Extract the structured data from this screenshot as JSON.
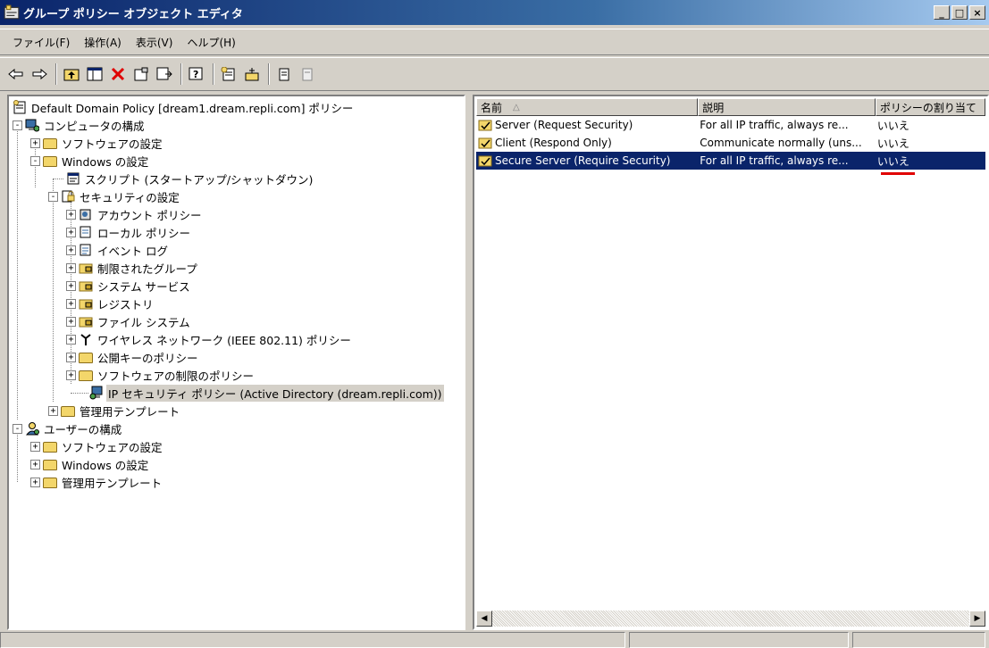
{
  "window": {
    "title": "グループ ポリシー オブジェクト エディタ",
    "buttons": {
      "minimize": "_",
      "maximize": "□",
      "close": "×"
    }
  },
  "menu": [
    "ファイル(F)",
    "操作(A)",
    "表示(V)",
    "ヘルプ(H)"
  ],
  "toolbar": {
    "icons": [
      "back-arrow-icon",
      "forward-arrow-icon",
      "up-folder-icon",
      "show-hide-tree-icon",
      "delete-icon",
      "properties-icon",
      "export-list-icon",
      "help-icon",
      "new-policy-icon",
      "add-icon",
      "assign-icon",
      "unassign-icon"
    ]
  },
  "tree": {
    "nodes": [
      {
        "label": "Default Domain Policy [dream1.dream.repli.com] ポリシー",
        "icon": "policy-icon"
      },
      {
        "label": "コンピュータの構成",
        "icon": "computer-config-icon",
        "expander": "-"
      },
      {
        "label": "ソフトウェアの設定",
        "icon": "folder-icon",
        "expander": "+"
      },
      {
        "label": "Windows の設定",
        "icon": "folder-icon",
        "expander": "-"
      },
      {
        "label": "スクリプト (スタートアップ/シャットダウン)",
        "icon": "script-icon"
      },
      {
        "label": "セキュリティの設定",
        "icon": "security-icon",
        "expander": "-"
      },
      {
        "label": "アカウント ポリシー",
        "icon": "account-policy-icon",
        "expander": "+"
      },
      {
        "label": "ローカル ポリシー",
        "icon": "local-policy-icon",
        "expander": "+"
      },
      {
        "label": "イベント ログ",
        "icon": "event-log-icon",
        "expander": "+"
      },
      {
        "label": "制限されたグループ",
        "icon": "secure-folder-icon",
        "expander": "+"
      },
      {
        "label": "システム サービス",
        "icon": "secure-folder-icon",
        "expander": "+"
      },
      {
        "label": "レジストリ",
        "icon": "secure-folder-icon",
        "expander": "+"
      },
      {
        "label": "ファイル システム",
        "icon": "secure-folder-icon",
        "expander": "+"
      },
      {
        "label": "ワイヤレス ネットワーク (IEEE 802.11) ポリシー",
        "icon": "wireless-icon",
        "expander": "+"
      },
      {
        "label": "公開キーのポリシー",
        "icon": "folder-icon",
        "expander": "+"
      },
      {
        "label": "ソフトウェアの制限のポリシー",
        "icon": "folder-icon",
        "expander": "+"
      },
      {
        "label": "IP セキュリティ ポリシー (Active Directory (dream.repli.com))",
        "icon": "ip-security-icon"
      },
      {
        "label": "管理用テンプレート",
        "icon": "folder-icon",
        "expander": "+"
      },
      {
        "label": "ユーザーの構成",
        "icon": "user-config-icon",
        "expander": "-"
      },
      {
        "label": "ソフトウェアの設定",
        "icon": "folder-icon",
        "expander": "+"
      },
      {
        "label": "Windows の設定",
        "icon": "folder-icon",
        "expander": "+"
      },
      {
        "label": "管理用テンプレート",
        "icon": "folder-icon",
        "expander": "+"
      }
    ]
  },
  "list": {
    "columns": [
      "名前",
      "説明",
      "ポリシーの割り当て"
    ],
    "sort_indicator": "△",
    "rows": [
      {
        "name": "Server (Request Security)",
        "desc": "For all IP traffic, always re...",
        "assigned": "いいえ"
      },
      {
        "name": "Client (Respond Only)",
        "desc": "Communicate normally (uns...",
        "assigned": "いいえ"
      },
      {
        "name": "Secure Server (Require Security)",
        "desc": "For all IP traffic, always re...",
        "assigned": "いいえ"
      }
    ]
  },
  "colors": {
    "selection": "#0a246a",
    "annotation": "#e00000",
    "chrome": "#d4d0c8"
  }
}
